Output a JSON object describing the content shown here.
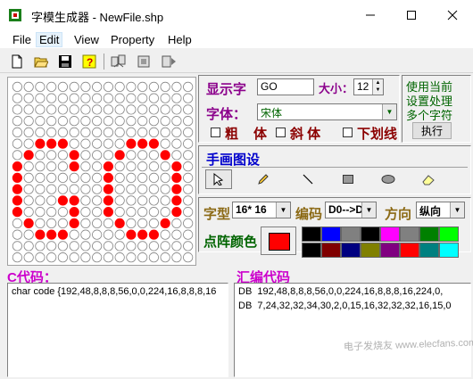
{
  "window": {
    "title": "字模生成器 - NewFile.shp",
    "controls": [
      "minimize",
      "maximize",
      "close"
    ]
  },
  "menu": [
    "File",
    "Edit",
    "View",
    "Property",
    "Help"
  ],
  "toolbar": {
    "icons": [
      "new-file-icon",
      "open-folder-icon",
      "save-disk-icon",
      "help-icon",
      "tool-a-icon",
      "tool-b-icon",
      "tool-c-icon"
    ]
  },
  "grid": {
    "rows": 16,
    "cols": 16,
    "on_color": "#ff0000",
    "off_color": "#ffffff",
    "row_bytes_left": [
      0,
      0,
      0,
      0,
      0,
      56,
      68,
      132,
      128,
      128,
      140,
      132,
      68,
      56,
      0,
      0
    ],
    "row_bytes_right": [
      0,
      0,
      0,
      0,
      0,
      56,
      68,
      130,
      130,
      130,
      130,
      130,
      68,
      56,
      0,
      0
    ]
  },
  "display": {
    "label": "显示字",
    "text_value": "GO",
    "size_label": "大小：",
    "size_value": "12",
    "font_label": "字体：",
    "font_value": "宋体",
    "bold_label": "粗",
    "bold_extra": "体",
    "italic_label": "斜 体",
    "underline_label": "下划线"
  },
  "multi": {
    "line1": "使用当前",
    "line2": "设置处理",
    "line3": "多个字符",
    "button": "执行"
  },
  "draw": {
    "title": "手画图设",
    "tools": [
      "pointer-icon",
      "pencil-icon",
      "line-icon",
      "rectangle-icon",
      "ellipse-icon",
      "eraser-icon"
    ]
  },
  "format": {
    "type_label": "字型",
    "type_value": "16* 16",
    "encode_label": "编码",
    "encode_value": "D0-->D",
    "dir_label": "方向",
    "dir_value": "纵向",
    "color_label": "点阵颜色",
    "current_color": "#ff0000",
    "palette": [
      "#000000",
      "#0000ff",
      "#808080",
      "#000000",
      "#ff00ff",
      "#808080",
      "#008000",
      "#00ff00",
      "#000000",
      "#800000",
      "#000080",
      "#808000",
      "#800080",
      "#ff0000",
      "#008080",
      "#00ffff"
    ]
  },
  "c_code": {
    "title": "C代码：",
    "text": "char code {192,48,8,8,8,56,0,0,224,16,8,8,8,16"
  },
  "asm_code": {
    "title": "汇编代码",
    "line1": "DB  192,48,8,8,8,56,0,0,224,16,8,8,8,16,224,0,",
    "line2": "DB  7,24,32,32,34,30,2,0,15,16,32,32,32,16,15,0"
  },
  "watermark": "电子发烧友 www.elecfans.com"
}
